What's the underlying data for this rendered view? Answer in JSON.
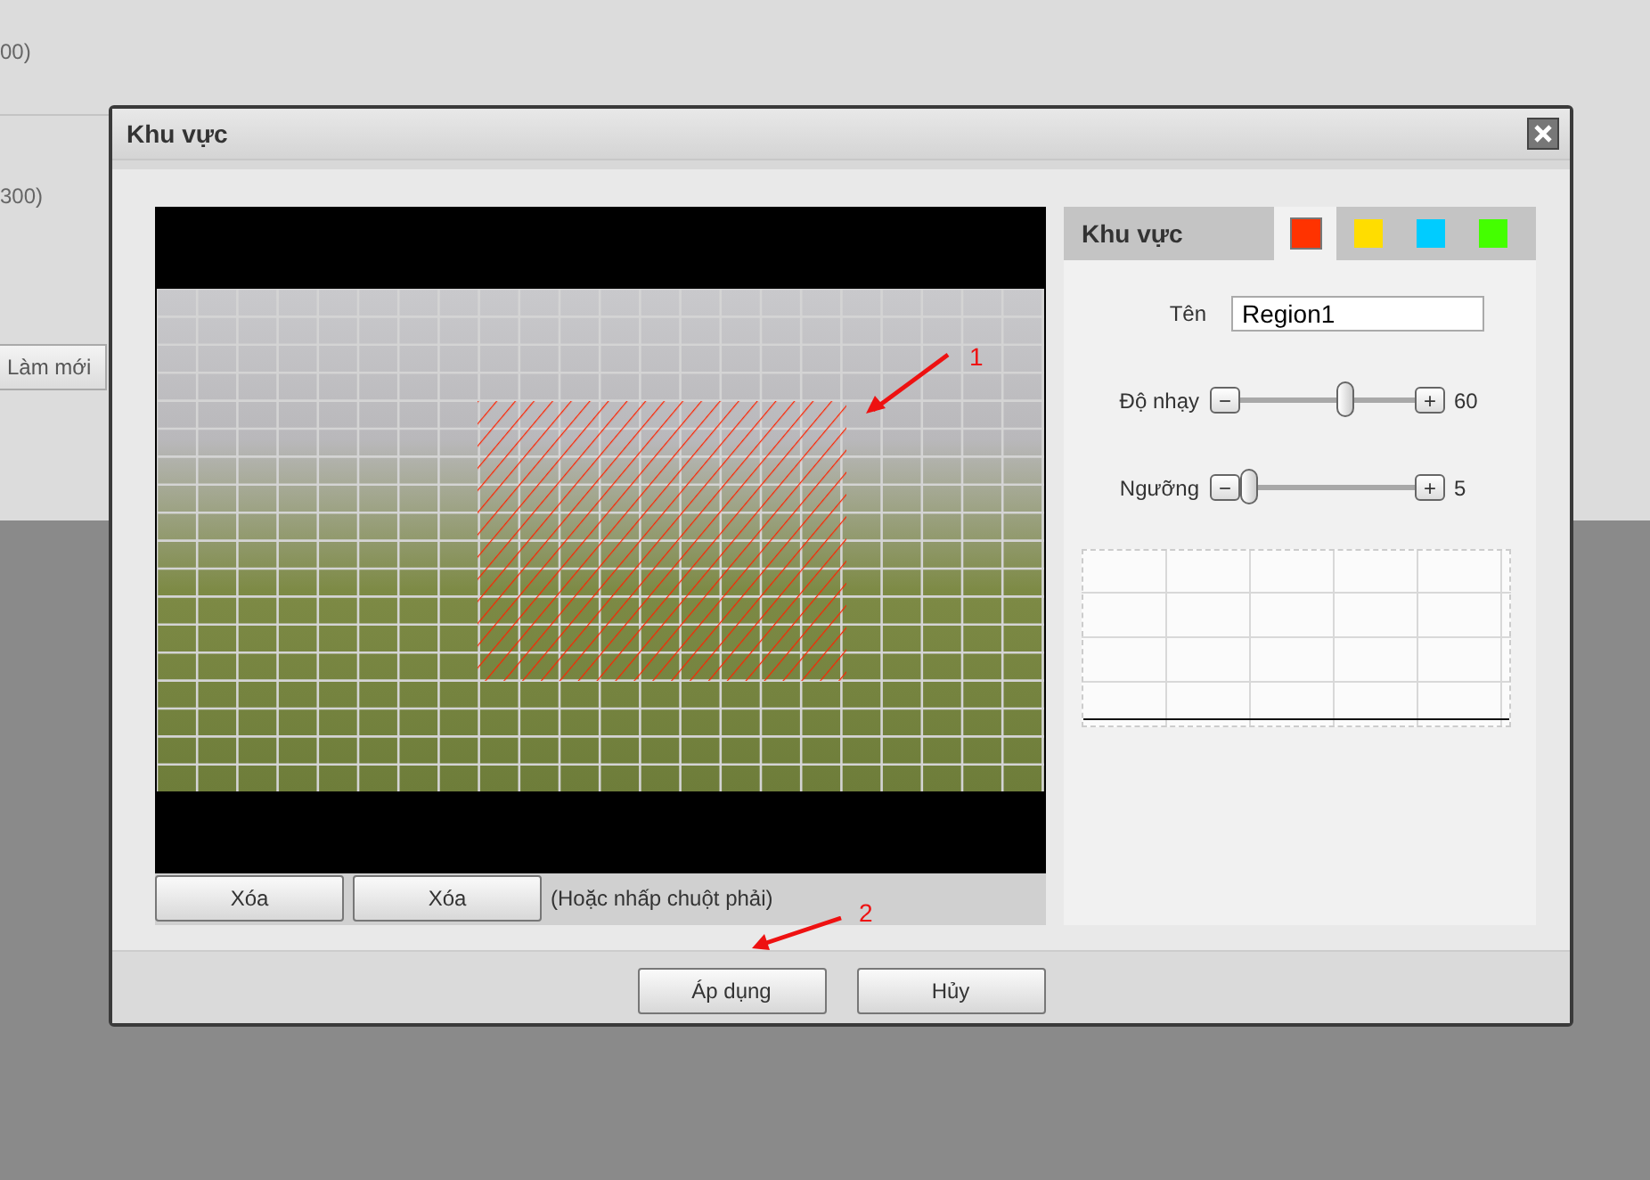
{
  "background": {
    "texts": [
      "00)",
      "300)"
    ],
    "refresh_button": "Làm mới"
  },
  "dialog": {
    "title": "Khu vực",
    "video_buttons": [
      "Xóa",
      "Xóa"
    ],
    "hint": "(Hoặc nhấp chuột phải)",
    "panel": {
      "title": "Khu vực",
      "colors": [
        {
          "color": "#ff3300",
          "selected": true
        },
        {
          "color": "#ffdd00",
          "selected": false
        },
        {
          "color": "#00ccff",
          "selected": false
        },
        {
          "color": "#44ff00",
          "selected": false
        }
      ],
      "name_label": "Tên",
      "name_value": "Region1",
      "sliders": [
        {
          "label": "Độ nhạy",
          "minus": "−",
          "plus": "+",
          "level": 0.6,
          "reading": "60"
        },
        {
          "label": "Ngưỡng",
          "minus": "−",
          "plus": "+",
          "level": 0.05,
          "reading": "5"
        }
      ]
    },
    "footer_buttons": [
      "Áp dụng",
      "Hủy"
    ]
  },
  "annotations": [
    {
      "label": "1"
    },
    {
      "label": "2"
    }
  ]
}
